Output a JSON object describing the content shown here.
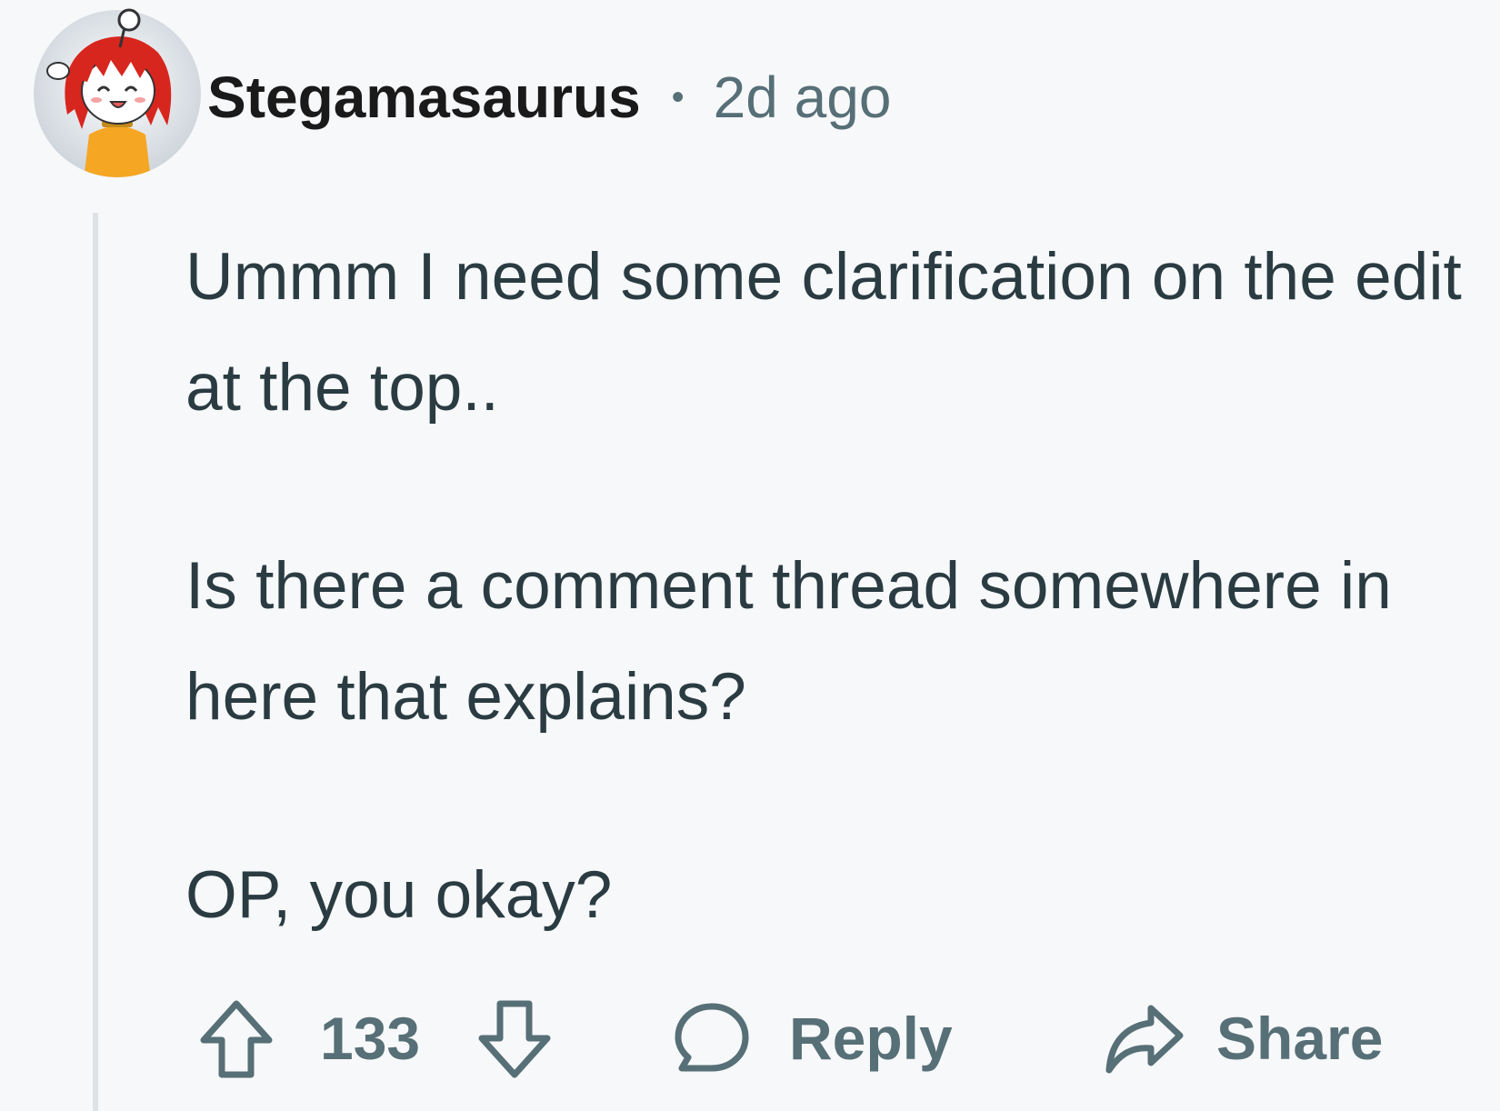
{
  "comment": {
    "author": "Stegamasaurus",
    "separator": "•",
    "time_ago": "2d ago",
    "paragraphs": [
      "Ummm I need some clarification on the edit at the top..",
      "Is there a comment thread somewhere in here that explains?",
      "OP, you okay?"
    ]
  },
  "actions": {
    "vote_count": "133",
    "reply_label": "Reply",
    "share_label": "Share"
  },
  "icons": {
    "avatar": "avatar-icon",
    "upvote": "arrow-up-icon",
    "downvote": "arrow-down-icon",
    "reply": "speech-bubble-icon",
    "share": "share-arrow-icon"
  },
  "colors": {
    "background": "#f7f8fa",
    "username": "#1a1a1b",
    "meta": "#576f76",
    "body_text": "#2a3c42",
    "thread_line": "#dde2e6",
    "avatar_hair": "#d7261e",
    "avatar_shirt": "#f5a623"
  }
}
